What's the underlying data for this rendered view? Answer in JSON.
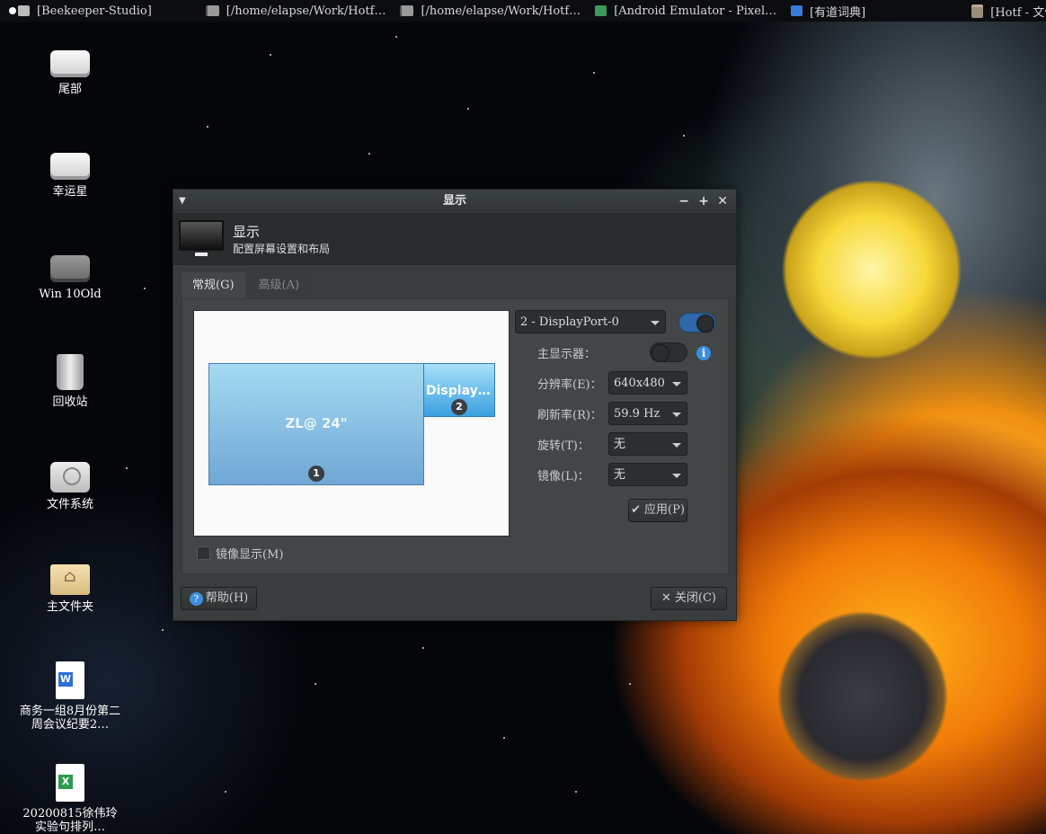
{
  "taskbar": {
    "items": [
      {
        "label": "[Beekeeper-Studio]",
        "icon": "window-icon"
      },
      {
        "label": "[/home/elapse/Work/Hotf…",
        "icon": "text-editor-icon"
      },
      {
        "label": "[/home/elapse/Work/Hotf…",
        "icon": "text-editor-icon"
      },
      {
        "label": "[Android Emulator - Pixel…",
        "icon": "android-emulator-icon"
      },
      {
        "label": "[有道词典]",
        "icon": "dictionary-icon"
      },
      {
        "label": "[Hotf - 文件管理器",
        "icon": "folder-icon"
      }
    ]
  },
  "desktop": {
    "icons": [
      {
        "label": "尾部",
        "icon": "drive-icon"
      },
      {
        "label": "幸运星",
        "icon": "drive-icon"
      },
      {
        "label": "Win 10Old",
        "icon": "drive-icon"
      },
      {
        "label": "回收站",
        "icon": "trash-icon"
      },
      {
        "label": "文件系统",
        "icon": "harddisk-icon"
      },
      {
        "label": "主文件夹",
        "icon": "home-folder-icon"
      },
      {
        "label": "商务一组8月份第二周会议纪要2…",
        "icon": "word-document-icon"
      },
      {
        "label": "20200815徐伟玲 实验句排列…",
        "icon": "excel-document-icon"
      }
    ]
  },
  "dialog": {
    "title": "显示",
    "header_title": "显示",
    "header_subtitle": "配置屏幕设置和布局",
    "tabs": [
      {
        "label": "常规(G)",
        "active": true
      },
      {
        "label": "高级(A)",
        "active": false
      }
    ],
    "monitors": [
      {
        "label": "ZL@ 24\"",
        "number": "1"
      },
      {
        "label": "Display…",
        "number": "2"
      }
    ],
    "mirror_label": "镜像显示(M)",
    "mirror_checked": false,
    "output_select": "2 - DisplayPort-0",
    "output_enabled": true,
    "primary_label": "主显示器：",
    "primary_enabled": false,
    "resolution_label": "分辨率(E)：",
    "resolution_value": "640x480",
    "refresh_label": "刷新率(R)：",
    "refresh_value": "59.9 Hz",
    "rotation_label": "旋转(T)：",
    "rotation_value": "无",
    "reflection_label": "镜像(L)：",
    "reflection_value": "无",
    "apply_label": "应用(P)",
    "help_label": "帮助(H)",
    "close_label": "关闭(C)",
    "accent_color": "#2e68a8"
  }
}
